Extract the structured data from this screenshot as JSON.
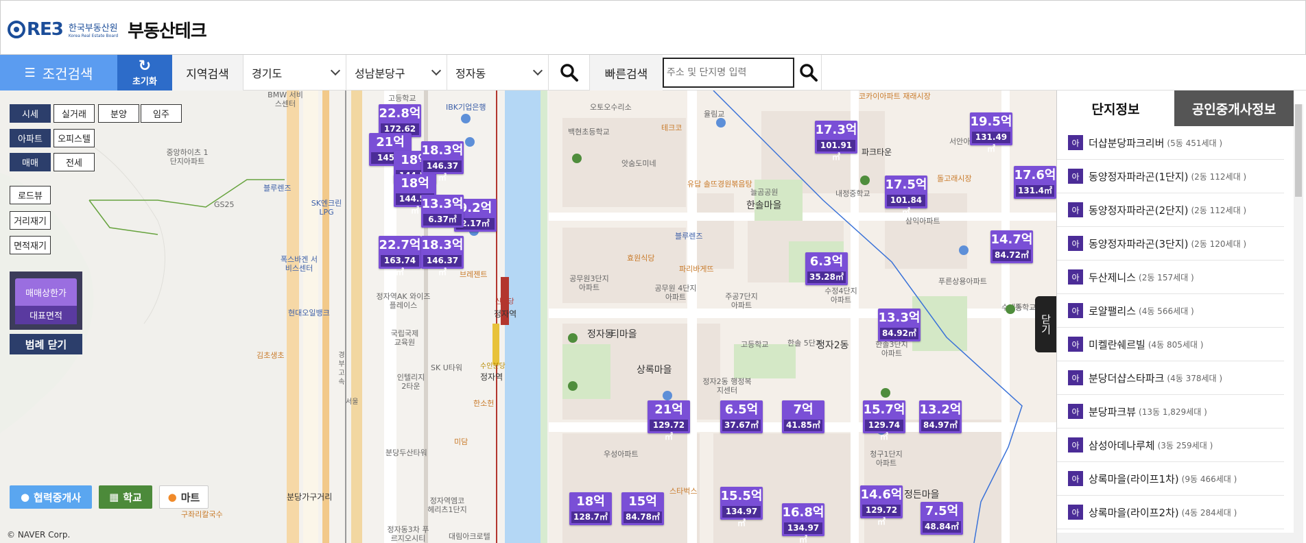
{
  "header": {
    "logo_mark": "RE3",
    "logo_org": "한국부동산원",
    "logo_org_en": "Korea Real Estate Board",
    "title": "부동산테크"
  },
  "toolbar": {
    "condition_search": "조건검색",
    "reset": "초기화",
    "region_label": "지역검색",
    "province": "경기도",
    "district": "성남분당구",
    "dong": "정자동",
    "quick_label": "빠른검색",
    "quick_placeholder": "주소 및 단지명 입력"
  },
  "left_panel": {
    "row1": [
      "시세",
      "실거래",
      "분양",
      "임주"
    ],
    "row2": [
      "아파트",
      "오피스텔"
    ],
    "row3": [
      "매매",
      "전세"
    ],
    "tools": [
      "로드뷰",
      "거리재기",
      "면적재기"
    ],
    "legend_a": "매매상한가",
    "legend_b": "대표면적",
    "legend_close": "범례 닫기"
  },
  "filters": {
    "broker": "협력중개사",
    "school": "학교",
    "mart": "마트"
  },
  "map": {
    "copyright": "© NAVER Corp.",
    "close_tab": "닫기",
    "markers": [
      {
        "price": "22.8억",
        "area": "172.62㎡"
      },
      {
        "price": "21억",
        "area": "145.4"
      },
      {
        "price": "18.3억",
        "area": "146.37㎡"
      },
      {
        "price": "18억",
        "area": "144.56㎡"
      },
      {
        "price": "18억",
        "area": "144.56㎡"
      },
      {
        "price": "13.3억",
        "area": "6.37㎡"
      },
      {
        "price": "9.2억",
        "area": "2.17㎡"
      },
      {
        "price": "22.7억",
        "area": "163.74㎡"
      },
      {
        "price": "18.3억",
        "area": "146.37㎡"
      },
      {
        "price": "17.3억",
        "area": "101.91㎡"
      },
      {
        "price": "19.5억",
        "area": "131.49㎡"
      },
      {
        "price": "17.5억",
        "area": "101.84㎡"
      },
      {
        "price": "17.6억",
        "area": "131.4㎡"
      },
      {
        "price": "14.7억",
        "area": "84.72㎡"
      },
      {
        "price": "6.3억",
        "area": "35.28㎡"
      },
      {
        "price": "13.3억",
        "area": "84.92㎡"
      },
      {
        "price": "21억",
        "area": "129.72㎡"
      },
      {
        "price": "6.5억",
        "area": "37.67㎡"
      },
      {
        "price": "7억",
        "area": "41.85㎡"
      },
      {
        "price": "15.7억",
        "area": "129.74㎡"
      },
      {
        "price": "13.2억",
        "area": "84.97㎡"
      },
      {
        "price": "18억",
        "area": "128.7㎡"
      },
      {
        "price": "15억",
        "area": "84.78㎡"
      },
      {
        "price": "15.5억",
        "area": "134.97㎡"
      },
      {
        "price": "16.8억",
        "area": "134.97㎡"
      },
      {
        "price": "14.6억",
        "area": "129.72㎡"
      },
      {
        "price": "7.5억",
        "area": "48.84㎡"
      }
    ],
    "labels": {
      "l1": "고등학교",
      "l2": "IBK기업은행",
      "l3": "오토오수리소",
      "l4": "백현초등학교",
      "l5": "테크코",
      "l6": "율림교",
      "l7": "코카이아파트 재래시장",
      "l8": "파크타운",
      "l9": "앗숨도미네",
      "l10": "유답 솔뜨경원볶음탕",
      "l11": "늘곰공원",
      "l12": "내정중학교",
      "l13": "서안아",
      "l14": "돌고래시장",
      "l15": "삼익아파트",
      "l16": "중앙하이츠 1단지아파트",
      "l17": "블루렌즈",
      "l18": "SK엔크린 LPG",
      "l19": "GS25",
      "l20": "폭스바겐 서비스센터",
      "l21": "현대오일뱅크",
      "l22": "김초생초",
      "l23": "정자역AK 와이즈플레이스",
      "l24": "국립국제 교육원",
      "l25": "SK U타워",
      "l26": "인텔리지 2타운",
      "l27": "브레젠트",
      "l28": "신분당",
      "l29": "정자역",
      "l30": "수인분당",
      "l31": "정자역",
      "l32": "한소헌",
      "l33": "미담",
      "l34": "분당두산타워",
      "l35": "분당가구거리",
      "l36": "정자역엠코 헤리츠1단지",
      "l37": "정자동3차 푸르지오시티",
      "l38": "대림아크로텔",
      "l39": "구좌리칼국수",
      "l40": "한솔마을",
      "l41": "공무원3단지 아파트",
      "l42": "공무원 4단지아파트",
      "l43": "주공7단지 아파트",
      "l44": "정자동",
      "l45": "티마을",
      "l46": "상록마을",
      "l47": "정자2동 행정복지센터",
      "l48": "우성아파트",
      "l49": "청구1단지 아파트",
      "l50": "정든마을",
      "l51": "스타벅스",
      "l52": "효원식당",
      "l53": "파리바게뜨",
      "l54": "블루렌즈",
      "l55": "정자2동",
      "l56": "한솔 5단지",
      "l57": "수정4단지 아파트",
      "l58": "한솔3단지 아파트",
      "l59": "푸른상용아파트",
      "l60": "수내동",
      "l61": "중학교",
      "l62": "고등학교",
      "l63": "BMW 서비스센터",
      "l64": "경부고속",
      "l65": "서울"
    }
  },
  "right_panel": {
    "tab_active": "단지정보",
    "tab_inactive": "공인중개사정보",
    "tag": "아",
    "items": [
      {
        "name": "더샵분당파크리버",
        "sub": "(5동 451세대 )"
      },
      {
        "name": "동양정자파라곤(1단지)",
        "sub": "(2동 112세대 )"
      },
      {
        "name": "동양정자파라곤(2단지)",
        "sub": "(2동 112세대 )"
      },
      {
        "name": "동양정자파라곤(3단지)",
        "sub": "(2동 120세대 )"
      },
      {
        "name": "두산제니스",
        "sub": "(2동 157세대 )"
      },
      {
        "name": "로얄팰리스",
        "sub": "(4동 566세대 )"
      },
      {
        "name": "미켈란쉐르빌",
        "sub": "(4동 805세대 )"
      },
      {
        "name": "분당더샵스타파크",
        "sub": "(4동 378세대 )"
      },
      {
        "name": "분당파크뷰",
        "sub": "(13동 1,829세대 )"
      },
      {
        "name": "삼성아데나루체",
        "sub": "(3동 259세대 )"
      },
      {
        "name": "상록마을(라이프1차)",
        "sub": "(9동 466세대 )"
      },
      {
        "name": "상록마을(라이프2차)",
        "sub": "(4동 284세대 )"
      }
    ]
  }
}
